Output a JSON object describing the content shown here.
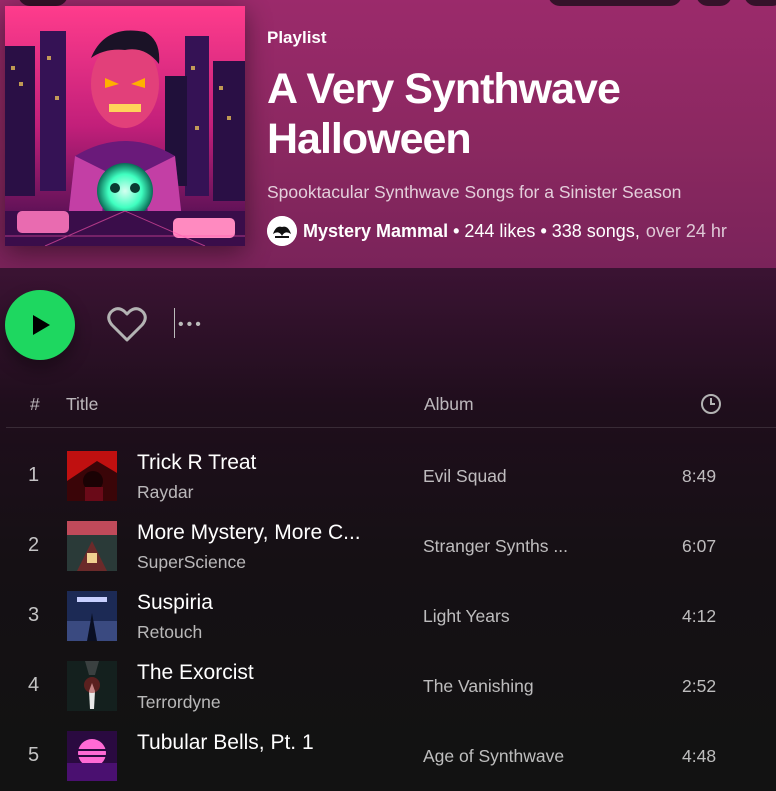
{
  "playlist": {
    "type_label": "Playlist",
    "title": "A Very Synthwave Halloween",
    "description": "Spooktacular Synthwave Songs for a Sinister Season",
    "owner": "Mystery Mammal",
    "likes": "244 likes",
    "songs": "338 songs,",
    "duration": "over 24 hr"
  },
  "table": {
    "col_num": "#",
    "col_title": "Title",
    "col_album": "Album",
    "col_duration_icon": "clock-icon"
  },
  "tracks": [
    {
      "num": "1",
      "title": "Trick R Treat",
      "artist": "Raydar",
      "album": "Evil Squad",
      "duration": "8:49"
    },
    {
      "num": "2",
      "title": "More Mystery, More C...",
      "artist": "SuperScience",
      "album": "Stranger Synths ...",
      "duration": "6:07"
    },
    {
      "num": "3",
      "title": "Suspiria",
      "artist": "Retouch",
      "album": "Light Years",
      "duration": "4:12"
    },
    {
      "num": "4",
      "title": "The Exorcist",
      "artist": "Terrordyne",
      "album": "The Vanishing",
      "duration": "2:52"
    },
    {
      "num": "5",
      "title": "Tubular Bells, Pt. 1",
      "artist": "",
      "album": "Age of Synthwave",
      "duration": "4:48"
    }
  ],
  "colors": {
    "accent": "#1ed760",
    "hero": "#8a2860"
  }
}
